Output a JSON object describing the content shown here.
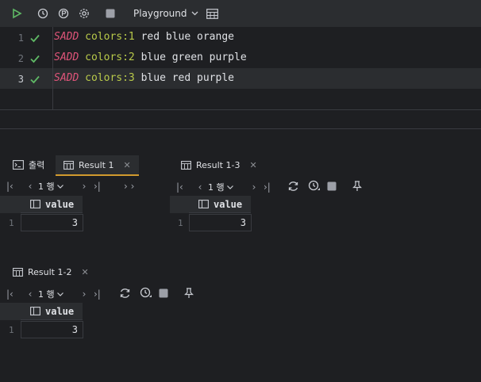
{
  "toolbar": {
    "icons": [
      "run-icon",
      "history-icon",
      "p-icon",
      "gear-icon",
      "stop-icon",
      "table-icon"
    ],
    "playground_label": "Playground"
  },
  "editor": {
    "lines": [
      {
        "num": "1",
        "cmd": "SADD",
        "key": "colors:1",
        "args": " red blue orange"
      },
      {
        "num": "2",
        "cmd": "SADD",
        "key": "colors:2",
        "args": " blue green purple"
      },
      {
        "num": "3",
        "cmd": "SADD",
        "key": "colors:3",
        "args": " blue red purple"
      }
    ]
  },
  "panel": {
    "output_tab": "출력",
    "result1": {
      "tab": "Result 1",
      "page": "1 행",
      "column": "value",
      "rows": [
        {
          "num": "1",
          "value": "3"
        }
      ]
    },
    "result13": {
      "tab": "Result 1-3",
      "page": "1 행",
      "column": "value",
      "rows": [
        {
          "num": "1",
          "value": "3"
        }
      ]
    },
    "result12": {
      "tab": "Result 1-2",
      "page": "1 행",
      "column": "value",
      "rows": [
        {
          "num": "1",
          "value": "3"
        }
      ]
    }
  },
  "colors": {
    "accent": "#d19a2e",
    "run_green": "#5fb865",
    "keyword": "#e0557a",
    "key": "#b9ca4a"
  }
}
